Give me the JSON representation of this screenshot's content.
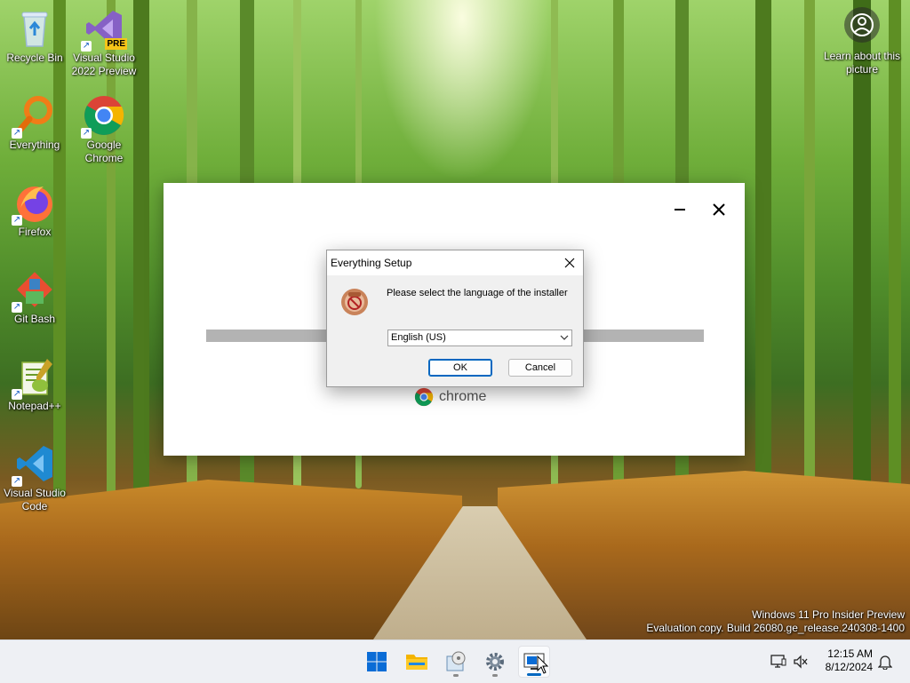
{
  "desktop": {
    "icons": [
      {
        "label": "Recycle Bin"
      },
      {
        "label": "Visual Studio 2022 Preview",
        "badge": "PRE"
      },
      {
        "label": "Everything"
      },
      {
        "label": "Google Chrome"
      },
      {
        "label": "Firefox"
      },
      {
        "label": "Git Bash"
      },
      {
        "label": "Notepad++"
      },
      {
        "label": "Visual Studio Code"
      }
    ],
    "learn_about": "Learn about this picture",
    "watermark_line1": "Windows 11 Pro Insider Preview",
    "watermark_line2": "Evaluation copy. Build 26080.ge_release.240308-1400"
  },
  "installer_window": {
    "brand": "chrome",
    "minimize_glyph": "—",
    "close_glyph": "✕"
  },
  "setup_dialog": {
    "title": "Everything Setup",
    "prompt": "Please select the language of the installer",
    "language_selected": "English (US)",
    "ok_label": "OK",
    "cancel_label": "Cancel"
  },
  "taskbar": {
    "apps": [
      "start-icon",
      "file-explorer-icon",
      "setup-app-icon",
      "settings-icon",
      "remote-desktop-icon"
    ],
    "time": "12:15 AM",
    "date": "8/12/2024"
  },
  "colors": {
    "accent": "#0067c0",
    "taskbar_bg": "#eef0f4",
    "dialog_bg": "#f0f0f0",
    "progress": "#b3b3b3"
  }
}
